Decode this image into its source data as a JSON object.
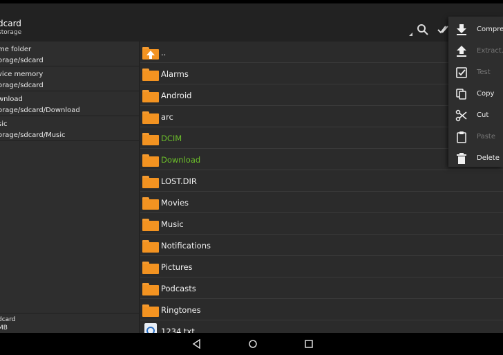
{
  "toolbar": {
    "title": "dcard",
    "subtitle": "storage",
    "icons": [
      "search-icon",
      "select-all-icon"
    ]
  },
  "sidebar": {
    "items": [
      {
        "name": "me folder",
        "path": "orage/sdcard"
      },
      {
        "name": "vice memory",
        "path": "orage/sdcard"
      },
      {
        "name": "wnload",
        "path": "orage/sdcard/Download"
      },
      {
        "name": "sic",
        "path": "orage/sdcard/Music"
      }
    ],
    "footer": {
      "name": "dcard",
      "size": "MB"
    }
  },
  "files": {
    "parent": "..",
    "items": [
      {
        "label": "Alarms",
        "highlight": false
      },
      {
        "label": "Android",
        "highlight": false
      },
      {
        "label": "arc",
        "highlight": false
      },
      {
        "label": "DCIM",
        "highlight": true
      },
      {
        "label": "Download",
        "highlight": true
      },
      {
        "label": "LOST.DIR",
        "highlight": false
      },
      {
        "label": "Movies",
        "highlight": false
      },
      {
        "label": "Music",
        "highlight": false
      },
      {
        "label": "Notifications",
        "highlight": false
      },
      {
        "label": "Pictures",
        "highlight": false
      },
      {
        "label": "Podcasts",
        "highlight": false
      },
      {
        "label": "Ringtones",
        "highlight": false
      }
    ],
    "last_file": "1234.txt"
  },
  "menu": {
    "items": [
      {
        "label": "Compress",
        "icon": "download-icon",
        "enabled": true
      },
      {
        "label": "Extract...",
        "icon": "upload-icon",
        "enabled": false
      },
      {
        "label": "Test",
        "icon": "checkbox-icon",
        "enabled": false
      },
      {
        "label": "Copy",
        "icon": "copy-icon",
        "enabled": true
      },
      {
        "label": "Cut",
        "icon": "scissors-icon",
        "enabled": true
      },
      {
        "label": "Paste",
        "icon": "clipboard-icon",
        "enabled": false
      },
      {
        "label": "Delete",
        "icon": "trash-icon",
        "enabled": true
      }
    ]
  },
  "colors": {
    "folder": "#f39321",
    "highlight_text": "#6cbf2a",
    "background": "#2b2b2b"
  }
}
